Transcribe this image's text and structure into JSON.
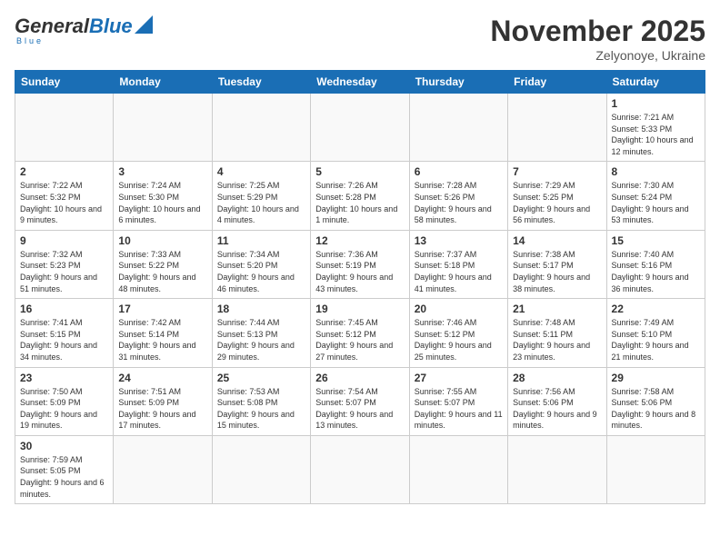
{
  "header": {
    "logo_general": "General",
    "logo_blue": "Blue",
    "logo_tagline": "Blue",
    "month_title": "November 2025",
    "location": "Zelyonoye, Ukraine"
  },
  "weekdays": [
    "Sunday",
    "Monday",
    "Tuesday",
    "Wednesday",
    "Thursday",
    "Friday",
    "Saturday"
  ],
  "weeks": [
    [
      {
        "day": "",
        "info": ""
      },
      {
        "day": "",
        "info": ""
      },
      {
        "day": "",
        "info": ""
      },
      {
        "day": "",
        "info": ""
      },
      {
        "day": "",
        "info": ""
      },
      {
        "day": "",
        "info": ""
      },
      {
        "day": "1",
        "info": "Sunrise: 7:21 AM\nSunset: 5:33 PM\nDaylight: 10 hours\nand 12 minutes."
      }
    ],
    [
      {
        "day": "2",
        "info": "Sunrise: 7:22 AM\nSunset: 5:32 PM\nDaylight: 10 hours\nand 9 minutes."
      },
      {
        "day": "3",
        "info": "Sunrise: 7:24 AM\nSunset: 5:30 PM\nDaylight: 10 hours\nand 6 minutes."
      },
      {
        "day": "4",
        "info": "Sunrise: 7:25 AM\nSunset: 5:29 PM\nDaylight: 10 hours\nand 4 minutes."
      },
      {
        "day": "5",
        "info": "Sunrise: 7:26 AM\nSunset: 5:28 PM\nDaylight: 10 hours\nand 1 minute."
      },
      {
        "day": "6",
        "info": "Sunrise: 7:28 AM\nSunset: 5:26 PM\nDaylight: 9 hours\nand 58 minutes."
      },
      {
        "day": "7",
        "info": "Sunrise: 7:29 AM\nSunset: 5:25 PM\nDaylight: 9 hours\nand 56 minutes."
      },
      {
        "day": "8",
        "info": "Sunrise: 7:30 AM\nSunset: 5:24 PM\nDaylight: 9 hours\nand 53 minutes."
      }
    ],
    [
      {
        "day": "9",
        "info": "Sunrise: 7:32 AM\nSunset: 5:23 PM\nDaylight: 9 hours\nand 51 minutes."
      },
      {
        "day": "10",
        "info": "Sunrise: 7:33 AM\nSunset: 5:22 PM\nDaylight: 9 hours\nand 48 minutes."
      },
      {
        "day": "11",
        "info": "Sunrise: 7:34 AM\nSunset: 5:20 PM\nDaylight: 9 hours\nand 46 minutes."
      },
      {
        "day": "12",
        "info": "Sunrise: 7:36 AM\nSunset: 5:19 PM\nDaylight: 9 hours\nand 43 minutes."
      },
      {
        "day": "13",
        "info": "Sunrise: 7:37 AM\nSunset: 5:18 PM\nDaylight: 9 hours\nand 41 minutes."
      },
      {
        "day": "14",
        "info": "Sunrise: 7:38 AM\nSunset: 5:17 PM\nDaylight: 9 hours\nand 38 minutes."
      },
      {
        "day": "15",
        "info": "Sunrise: 7:40 AM\nSunset: 5:16 PM\nDaylight: 9 hours\nand 36 minutes."
      }
    ],
    [
      {
        "day": "16",
        "info": "Sunrise: 7:41 AM\nSunset: 5:15 PM\nDaylight: 9 hours\nand 34 minutes."
      },
      {
        "day": "17",
        "info": "Sunrise: 7:42 AM\nSunset: 5:14 PM\nDaylight: 9 hours\nand 31 minutes."
      },
      {
        "day": "18",
        "info": "Sunrise: 7:44 AM\nSunset: 5:13 PM\nDaylight: 9 hours\nand 29 minutes."
      },
      {
        "day": "19",
        "info": "Sunrise: 7:45 AM\nSunset: 5:12 PM\nDaylight: 9 hours\nand 27 minutes."
      },
      {
        "day": "20",
        "info": "Sunrise: 7:46 AM\nSunset: 5:12 PM\nDaylight: 9 hours\nand 25 minutes."
      },
      {
        "day": "21",
        "info": "Sunrise: 7:48 AM\nSunset: 5:11 PM\nDaylight: 9 hours\nand 23 minutes."
      },
      {
        "day": "22",
        "info": "Sunrise: 7:49 AM\nSunset: 5:10 PM\nDaylight: 9 hours\nand 21 minutes."
      }
    ],
    [
      {
        "day": "23",
        "info": "Sunrise: 7:50 AM\nSunset: 5:09 PM\nDaylight: 9 hours\nand 19 minutes."
      },
      {
        "day": "24",
        "info": "Sunrise: 7:51 AM\nSunset: 5:09 PM\nDaylight: 9 hours\nand 17 minutes."
      },
      {
        "day": "25",
        "info": "Sunrise: 7:53 AM\nSunset: 5:08 PM\nDaylight: 9 hours\nand 15 minutes."
      },
      {
        "day": "26",
        "info": "Sunrise: 7:54 AM\nSunset: 5:07 PM\nDaylight: 9 hours\nand 13 minutes."
      },
      {
        "day": "27",
        "info": "Sunrise: 7:55 AM\nSunset: 5:07 PM\nDaylight: 9 hours\nand 11 minutes."
      },
      {
        "day": "28",
        "info": "Sunrise: 7:56 AM\nSunset: 5:06 PM\nDaylight: 9 hours\nand 9 minutes."
      },
      {
        "day": "29",
        "info": "Sunrise: 7:58 AM\nSunset: 5:06 PM\nDaylight: 9 hours\nand 8 minutes."
      }
    ],
    [
      {
        "day": "30",
        "info": "Sunrise: 7:59 AM\nSunset: 5:05 PM\nDaylight: 9 hours\nand 6 minutes."
      },
      {
        "day": "",
        "info": ""
      },
      {
        "day": "",
        "info": ""
      },
      {
        "day": "",
        "info": ""
      },
      {
        "day": "",
        "info": ""
      },
      {
        "day": "",
        "info": ""
      },
      {
        "day": "",
        "info": ""
      }
    ]
  ]
}
